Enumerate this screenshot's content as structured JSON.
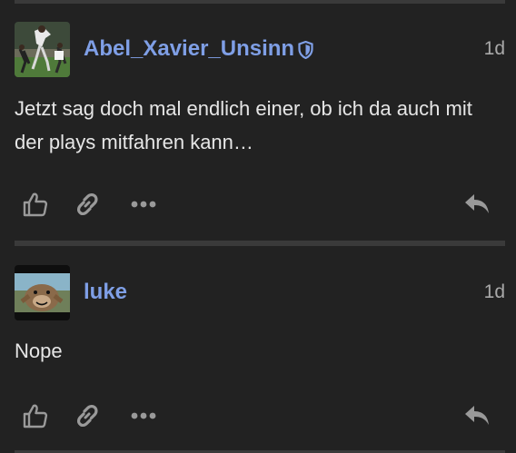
{
  "posts": [
    {
      "username": "Abel_Xavier_Unsinn",
      "date": "1d",
      "body": "Jetzt sag doch mal endlich einer, ob ich da auch mit der plays mitfahren kann…",
      "badge_icon": "shield-icon",
      "actions": [
        "like-icon",
        "link-icon",
        "more-icon",
        "reply-icon"
      ]
    },
    {
      "username": "luke",
      "date": "1d",
      "body": "Nope",
      "actions": [
        "like-icon",
        "link-icon",
        "more-icon",
        "reply-icon"
      ]
    }
  ],
  "colors": {
    "background": "#222222",
    "username": "#7f9fe6",
    "text": "#e6e6e6",
    "muted": "#a9a9a9",
    "icon": "#9a9a9a",
    "divider": "#3a3a3a"
  }
}
